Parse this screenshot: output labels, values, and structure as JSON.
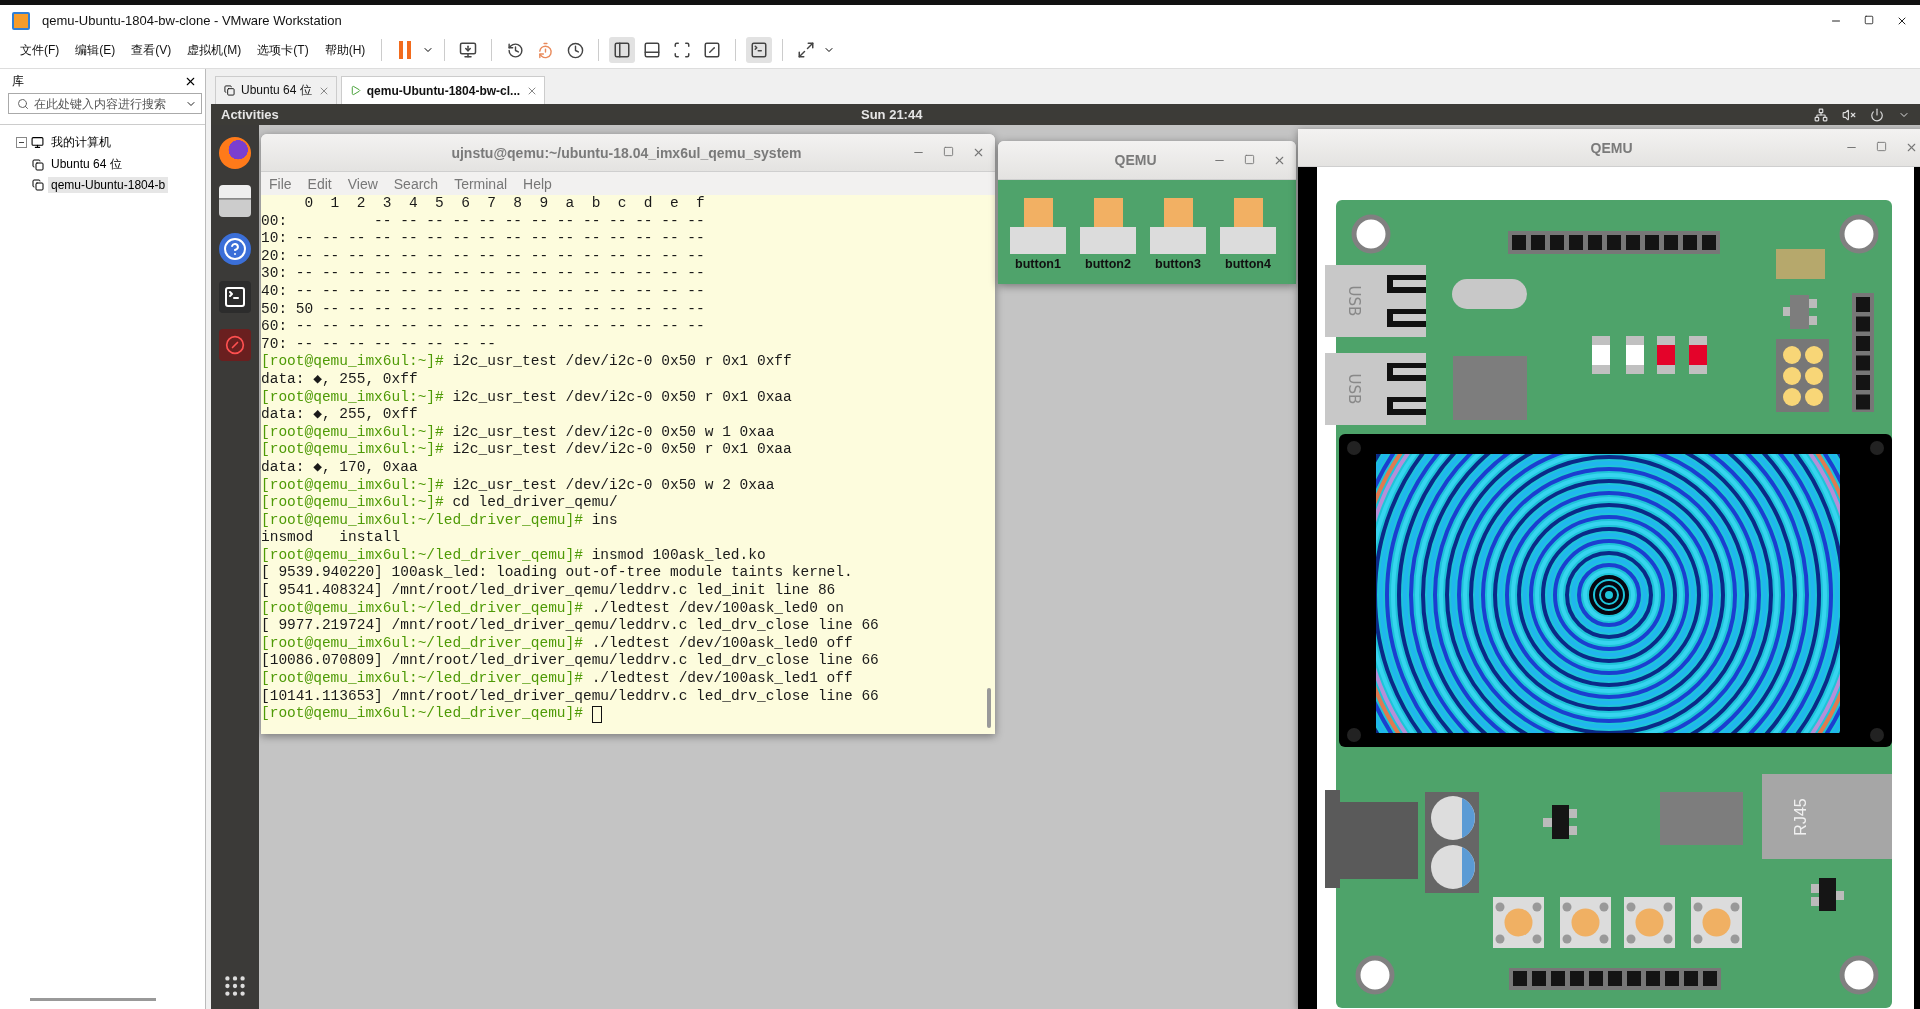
{
  "window": {
    "title": "qemu-Ubuntu-1804-bw-clone - VMware Workstation"
  },
  "menu": [
    "文件(F)",
    "编辑(E)",
    "查看(V)",
    "虚拟机(M)",
    "选项卡(T)",
    "帮助(H)"
  ],
  "library": {
    "title": "库",
    "search": {
      "placeholder": "在此处键入内容进行搜索"
    },
    "tree": [
      {
        "label": "我的计算机",
        "expanded": true,
        "children": [
          {
            "label": "Ubuntu 64 位",
            "selected": false
          },
          {
            "label": "qemu-Ubuntu-1804-b",
            "selected": true
          }
        ]
      }
    ]
  },
  "tabs": [
    {
      "label": "Ubuntu 64 位",
      "selected": false
    },
    {
      "label": "qemu-Ubuntu-1804-bw-cl...",
      "selected": true
    }
  ],
  "guest": {
    "top_bar": {
      "activities": "Activities",
      "clock": "Sun 21:44"
    },
    "terminal": {
      "title": "ujnstu@qemu:~/ubuntu-18.04_imx6ul_qemu_system",
      "menu": [
        "File",
        "Edit",
        "View",
        "Search",
        "Terminal",
        "Help"
      ],
      "lines": [
        {
          "text": "     0  1  2  3  4  5  6  7  8  9  a  b  c  d  e  f"
        },
        {
          "text": "00:          -- -- -- -- -- -- -- -- -- -- -- -- --"
        },
        {
          "text": "10: -- -- -- -- -- -- -- -- -- -- -- -- -- -- -- --"
        },
        {
          "text": "20: -- -- -- -- -- -- -- -- -- -- -- -- -- -- -- --"
        },
        {
          "text": "30: -- -- -- -- -- -- -- -- -- -- -- -- -- -- -- --"
        },
        {
          "text": "40: -- -- -- -- -- -- -- -- -- -- -- -- -- -- -- --"
        },
        {
          "text": "50: 50 -- -- -- -- -- -- -- -- -- -- -- -- -- -- --"
        },
        {
          "text": "60: -- -- -- -- -- -- -- -- -- -- -- -- -- -- -- --"
        },
        {
          "text": "70: -- -- -- -- -- -- -- --"
        },
        {
          "prompt": "[root@qemu_imx6ul:~]#",
          "text": "i2c_usr_test /dev/i2c-0 0x50 r 0x1 0xff"
        },
        {
          "text": "data: ◆, 255, 0xff"
        },
        {
          "prompt": "[root@qemu_imx6ul:~]#",
          "text": "i2c_usr_test /dev/i2c-0 0x50 r 0x1 0xaa"
        },
        {
          "text": "data: ◆, 255, 0xff"
        },
        {
          "prompt": "[root@qemu_imx6ul:~]#",
          "text": "i2c_usr_test /dev/i2c-0 0x50 w 1 0xaa"
        },
        {
          "prompt": "[root@qemu_imx6ul:~]#",
          "text": "i2c_usr_test /dev/i2c-0 0x50 r 0x1 0xaa"
        },
        {
          "text": "data: ◆, 170, 0xaa"
        },
        {
          "prompt": "[root@qemu_imx6ul:~]#",
          "text": "i2c_usr_test /dev/i2c-0 0x50 w 2 0xaa"
        },
        {
          "prompt": "[root@qemu_imx6ul:~]#",
          "text": "cd led_driver_qemu/"
        },
        {
          "prompt": "[root@qemu_imx6ul:~/led_driver_qemu]#",
          "text": "ins"
        },
        {
          "text": "insmod   install"
        },
        {
          "prompt": "[root@qemu_imx6ul:~/led_driver_qemu]#",
          "text": "insmod 100ask_led.ko"
        },
        {
          "text": "[ 9539.940220] 100ask_led: loading out-of-tree module taints kernel."
        },
        {
          "text": "[ 9541.408324] /mnt/root/led_driver_qemu/leddrv.c led_init line 86"
        },
        {
          "prompt": "[root@qemu_imx6ul:~/led_driver_qemu]#",
          "text": "./ledtest /dev/100ask_led0 on"
        },
        {
          "text": "[ 9977.219724] /mnt/root/led_driver_qemu/leddrv.c led_drv_close line 66"
        },
        {
          "prompt": "[root@qemu_imx6ul:~/led_driver_qemu]#",
          "text": "./ledtest /dev/100ask_led0 off"
        },
        {
          "text": "[10086.070809] /mnt/root/led_driver_qemu/leddrv.c led_drv_close line 66"
        },
        {
          "prompt": "[root@qemu_imx6ul:~/led_driver_qemu]#",
          "text": "./ledtest /dev/100ask_led1 off"
        },
        {
          "text": "[10141.113653] /mnt/root/led_driver_qemu/leddrv.c led_drv_close line 66"
        },
        {
          "prompt": "[root@qemu_imx6ul:~/led_driver_qemu]#",
          "cursor": true
        }
      ]
    },
    "button_window": {
      "title": "QEMU",
      "buttons": [
        {
          "label": "button1"
        },
        {
          "label": "button2"
        },
        {
          "label": "button3"
        },
        {
          "label": "button4"
        }
      ]
    },
    "board_window": {
      "title": "QEMU",
      "usb_labels": [
        "USB",
        "USB"
      ],
      "ethernet_label": "RJ45",
      "leds": [
        {
          "on": false
        },
        {
          "on": false
        },
        {
          "on": true
        },
        {
          "on": true
        }
      ]
    }
  }
}
